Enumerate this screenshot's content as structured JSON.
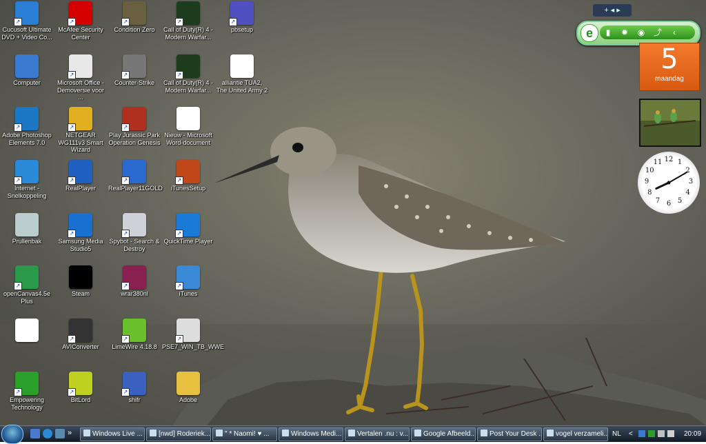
{
  "desktop_icons": [
    {
      "label": "Cucusoft Ultimate DVD + Video Co...",
      "icon": "cucusoft-icon",
      "color": "#2a7fd4"
    },
    {
      "label": "McAfee Security Center",
      "icon": "mcafee-icon",
      "color": "#d40000"
    },
    {
      "label": "Condition Zero",
      "icon": "counter-strike-cz-icon",
      "color": "#6a6040"
    },
    {
      "label": "Call of Duty(R) 4 - Modern Warfar...",
      "icon": "cod4-icon",
      "color": "#1d3b1d"
    },
    {
      "label": "pbsetup",
      "icon": "pbsetup-icon",
      "color": "#5050c0"
    },
    {
      "label": "Computer",
      "icon": "computer-icon",
      "color": "#3a7ad0"
    },
    {
      "label": "Microsoft Office - Demoversie voor ...",
      "icon": "office-icon",
      "color": "#e8e8e8"
    },
    {
      "label": "Counter-Strike",
      "icon": "counter-strike-icon",
      "color": "#777"
    },
    {
      "label": "Call of Duty(R) 4 - Modern Warfar...",
      "icon": "cod4-icon",
      "color": "#1d3b1d"
    },
    {
      "label": "alliantie TUA2, The United Army 2",
      "icon": "document-icon",
      "color": "#fff"
    },
    {
      "label": "Adobe Photoshop Elements 7.0",
      "icon": "photoshop-elements-icon",
      "color": "#1c78c4"
    },
    {
      "label": "NETGEAR WG111v3 Smart Wizard",
      "icon": "netgear-icon",
      "color": "#e0b020"
    },
    {
      "label": "Play Jurassic Park Operation Genesis",
      "icon": "jurassic-park-icon",
      "color": "#b03020"
    },
    {
      "label": "Nieuw - Microsoft Word-document",
      "icon": "word-document-icon",
      "color": "#fff"
    },
    {
      "label": "Internet - Snelkoppeling",
      "icon": "internet-explorer-icon",
      "color": "#2a8ad8"
    },
    {
      "label": "RealPlayer",
      "icon": "realplayer-icon",
      "color": "#2060c0"
    },
    {
      "label": "RealPlayer11GOLD",
      "icon": "realplayer-gold-icon",
      "color": "#2a6ad0"
    },
    {
      "label": "iTunesSetup",
      "icon": "itunes-setup-icon",
      "color": "#c04818"
    },
    {
      "label": "Prullenbak",
      "icon": "recycle-bin-icon",
      "color": "#bcc"
    },
    {
      "label": "Samsung Media Studio5",
      "icon": "samsung-media-icon",
      "color": "#1a70d0"
    },
    {
      "label": "Spybot - Search & Destroy",
      "icon": "spybot-icon",
      "color": "#d0d0d8"
    },
    {
      "label": "QuickTime Player",
      "icon": "quicktime-icon",
      "color": "#1a7ad8"
    },
    {
      "label": "openCanvas4.5e Plus",
      "icon": "opencanvas-icon",
      "color": "#2a9a4a"
    },
    {
      "label": "Steam",
      "icon": "steam-icon",
      "color": "#000"
    },
    {
      "label": "wrar380nl",
      "icon": "winrar-icon",
      "color": "#8a2050"
    },
    {
      "label": "iTunes",
      "icon": "itunes-icon",
      "color": "#3a8ad8"
    },
    {
      "label": "",
      "icon": "blank-file-icon",
      "color": "#fff"
    },
    {
      "label": "AVIConverter",
      "icon": "aviconverter-icon",
      "color": "#333"
    },
    {
      "label": "LimeWire 4.18.8",
      "icon": "limewire-icon",
      "color": "#6ac02a"
    },
    {
      "label": "PSE7_WIN_TB_WWE",
      "icon": "adobe-package-icon",
      "color": "#ddd"
    },
    {
      "label": "Empowering Technology",
      "icon": "empowering-technology-icon",
      "color": "#2aa02a"
    },
    {
      "label": "BitLord",
      "icon": "bitlord-icon",
      "color": "#c0d020"
    },
    {
      "label": "shifr",
      "icon": "shifr-icon",
      "color": "#3a60c0"
    },
    {
      "label": "Adobe",
      "icon": "folder-icon",
      "color": "#e8c040"
    }
  ],
  "gadget_toolbar": {
    "label": "+ ◂ ▸"
  },
  "ebar": {
    "logo": "e",
    "buttons": [
      "▮",
      "✹",
      "◉",
      "⤴",
      "‹"
    ]
  },
  "calendar": {
    "day": "5",
    "weekday": "maandag"
  },
  "clock": {
    "hour": 8,
    "minute": 10
  },
  "taskbar": {
    "quicklaunch_more": "»",
    "buttons": [
      {
        "label": "Windows Live ..."
      },
      {
        "label": "[nwd] Roderiek..."
      },
      {
        "label": "\" * Naomi! ♥ ..."
      },
      {
        "label": "Windows Medi..."
      },
      {
        "label": "Vertalen .nu : v..."
      },
      {
        "label": "Google Afbeeld..."
      },
      {
        "label": "Post Your Desk ..."
      },
      {
        "label": "vogel verzameli..."
      }
    ],
    "language": "NL",
    "tray_arrow": "<",
    "time": "20:09"
  }
}
